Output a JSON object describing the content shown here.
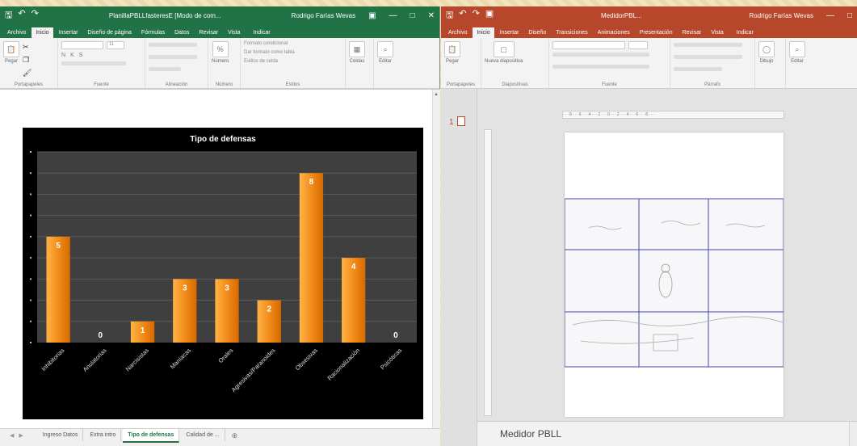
{
  "excel": {
    "window": {
      "title": "PlanillaPBLLfasteresE [Modo de com...",
      "user": "Rodrigo Farías Wevas",
      "accent": "#217346"
    },
    "ribbon_tabs": [
      "Archivo",
      "Inicio",
      "Insertar",
      "Diseño de página",
      "Fórmulas",
      "Datos",
      "Revisar",
      "Vista",
      "Indicar"
    ],
    "active_tab": "Inicio",
    "ribbon_groups": {
      "clipboard": "Portapapeles",
      "font": "Fuente",
      "alignment": "Alineación",
      "number": "Número",
      "styles": "Estilos",
      "cells": "Celdas",
      "editing": "Editar"
    },
    "ribbon_buttons": {
      "paste": "Pegar",
      "number_btn": "Número",
      "cond_format": "Formato condicional",
      "table_format": "Dar formato como tabla",
      "cell_styles": "Estilos de celda",
      "font_size": "11"
    },
    "sheet_tabs": [
      "Ingreso Datos",
      "Extra intro",
      "Tipo de defensas",
      "Calidad de ..."
    ],
    "active_sheet": "Tipo de defensas"
  },
  "chart_data": {
    "type": "bar",
    "title": "Tipo de defensas",
    "categories": [
      "Inhibitorias",
      "Anulatorias",
      "Narcisistas",
      "Maníacas",
      "Orales",
      "Agresivas/Paranoides",
      "Obsesivas",
      "Racionalización",
      "Psicóticas"
    ],
    "values": [
      5,
      0,
      1,
      3,
      3,
      2,
      8,
      4,
      0
    ],
    "data_labels": [
      "5",
      "0",
      "1",
      "3",
      "3",
      "2",
      "8",
      "4",
      "0"
    ],
    "ylim": [
      0,
      9
    ],
    "bar_color": "#f28c1a",
    "background": "#000000",
    "plot_background": "#3f3f3f",
    "grid": true,
    "xlabel": "",
    "ylabel": ""
  },
  "powerpoint": {
    "window": {
      "title": "MedidorPBL...",
      "user": "Rodrigo Farías Wevas",
      "accent": "#b7472a"
    },
    "ribbon_tabs": [
      "Archivo",
      "Inicio",
      "Insertar",
      "Diseño",
      "Transiciones",
      "Animaciones",
      "Presentación",
      "Revisar",
      "Vista",
      "Indicar"
    ],
    "active_tab": "Inicio",
    "ribbon_groups": {
      "clipboard": "Portapapeles",
      "slides": "Diapositivas",
      "font": "Fuente",
      "paragraph": "Párrafo"
    },
    "ribbon_buttons": {
      "paste": "Pegar",
      "new_slide": "Nueva diapositiva",
      "draw": "Dibujo",
      "edit": "Editar"
    },
    "slide_number": "1",
    "notes_text": "Medidor PBLL"
  }
}
